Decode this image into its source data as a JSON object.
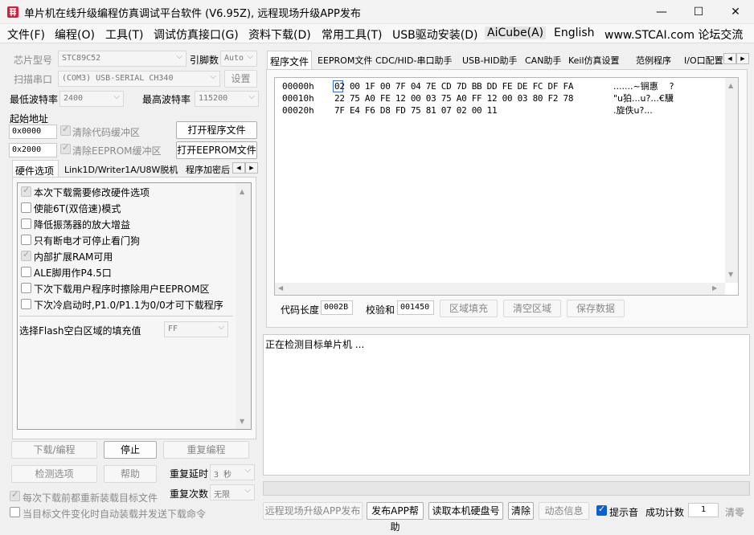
{
  "window": {
    "title": "单片机在线升级编程仿真调试平台软件 (V6.95Z), 远程现场升级APP发布",
    "minimize": "—",
    "maximize": "☐",
    "close": "✕"
  },
  "menu": [
    "文件(F)",
    "编程(O)",
    "工具(T)",
    "调试仿真接口(G)",
    "资料下载(D)",
    "常用工具(T)",
    "USB驱动安装(D)",
    "AiCube(A)",
    "English",
    "www.STCAI.com 论坛交流"
  ],
  "left": {
    "chip_label": "芯片型号",
    "chip_value": "STC89C52",
    "pin_label": "引脚数",
    "pin_value": "Auto",
    "scan_label": "扫描串口",
    "port_value": "(COM3) USB-SERIAL CH340",
    "settings_btn": "设置",
    "min_baud_label": "最低波特率",
    "min_baud_value": "2400",
    "max_baud_label": "最高波特率",
    "max_baud_value": "115200",
    "start_addr_label": "起始地址",
    "code_addr": "0x0000",
    "clear_code": "清除代码缓冲区",
    "open_program": "打开程序文件",
    "eeprom_addr": "0x2000",
    "clear_eeprom": "清除EEPROM缓冲区",
    "open_eeprom": "打开EEPROM文件"
  },
  "opt_tabs": [
    "硬件选项",
    "Link1D/Writer1A/U8W脱机",
    "程序加密后"
  ],
  "hw_options": [
    {
      "label": "本次下载需要修改硬件选项",
      "state": "disabled"
    },
    {
      "label": "使能6T(双倍速)模式",
      "state": "off"
    },
    {
      "label": "降低振荡器的放大增益",
      "state": "off"
    },
    {
      "label": "只有断电才可停止看门狗",
      "state": "off"
    },
    {
      "label": "内部扩展RAM可用",
      "state": "disabled"
    },
    {
      "label": "ALE脚用作P4.5口",
      "state": "off"
    },
    {
      "label": "下次下载用户程序时擦除用户EEPROM区",
      "state": "off"
    },
    {
      "label": "下次冷启动时,P1.0/P1.1为0/0才可下载程序",
      "state": "off"
    }
  ],
  "flash_fill_label": "选择Flash空白区域的填充值",
  "flash_fill_value": "FF",
  "actions": {
    "download": "下载/编程",
    "stop": "停止",
    "reprogram": "重复编程",
    "check": "检测选项",
    "help": "帮助",
    "repeat_delay_label": "重复延时",
    "repeat_delay_value": "3 秒",
    "repeat_count_label": "重复次数",
    "repeat_count_value": "无限",
    "reload_each": "每次下载前都重新装载目标文件",
    "auto_load": "当目标文件变化时自动装载并发送下载命令"
  },
  "right_tabs": [
    "程序文件",
    "EEPROM文件",
    "CDC/HID-串口助手",
    "USB-HID助手",
    "CAN助手",
    "Keil仿真设置",
    "范例程序",
    "I/O口配置"
  ],
  "hex": {
    "addresses": [
      "00000h",
      "00010h",
      "00020h"
    ],
    "rows": [
      "02 00 1F 00 7F 04 7E CD 7D BB DD FE DE FC DF FA",
      "22 75 A0 FE 12 00 03 75 A0 FF 12 00 03 80 F2 78",
      "7F E4 F6 D8 FD 75 81 07 02 00 11"
    ],
    "ascii": [
      ".......~锎惠    ?",
      "\"u狛...u?...€驥",
      ".旋佚u?..."
    ]
  },
  "code_info": {
    "length_label": "代码长度",
    "length_value": "0002B",
    "checksum_label": "校验和",
    "checksum_value": "001450",
    "fill_btn": "区域填充",
    "clear_btn": "清空区域",
    "save_btn": "保存数据"
  },
  "log_text": "正在检测目标单片机 ...",
  "bottom": {
    "remote_btn": "远程现场升级APP发布",
    "publish_help": "发布APP帮助",
    "read_disk": "读取本机硬盘号",
    "clear": "清除",
    "dynamic": "动态信息",
    "beep": "提示音",
    "success_label": "成功计数",
    "success_count": "1",
    "zero": "清零"
  },
  "colors": {
    "accent": "#0a5fd1",
    "title_icon": "#d2223c"
  }
}
